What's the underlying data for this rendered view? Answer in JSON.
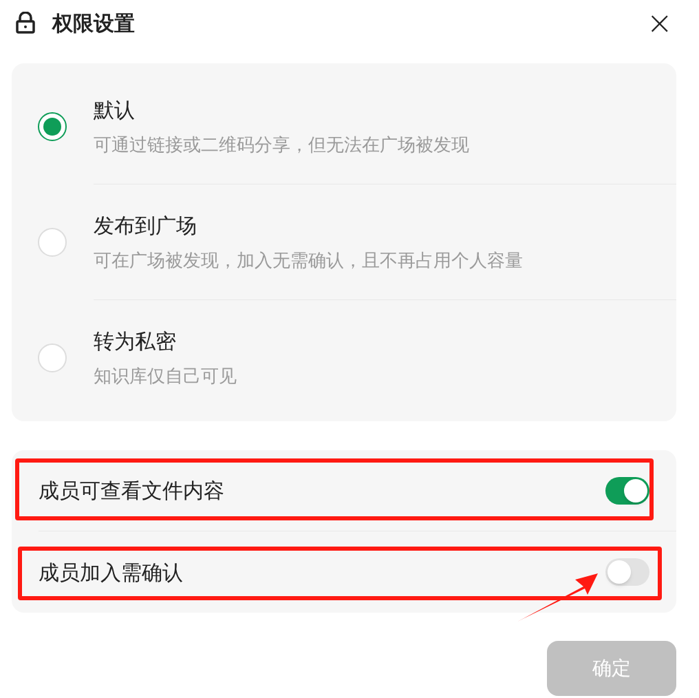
{
  "dialog": {
    "title": "权限设置",
    "close": "×"
  },
  "options": [
    {
      "label": "默认",
      "description": "可通过链接或二维码分享，但无法在广场被发现",
      "selected": true
    },
    {
      "label": "发布到广场",
      "description": "可在广场被发现，加入无需确认，且不再占用个人容量",
      "selected": false
    },
    {
      "label": "转为私密",
      "description": "知识库仅自己可见",
      "selected": false
    }
  ],
  "switches": [
    {
      "label": "成员可查看文件内容",
      "on": true,
      "highlighted": true
    },
    {
      "label": "成员加入需确认",
      "on": false,
      "highlighted": true,
      "pointed": true
    }
  ],
  "button": {
    "label": "确定",
    "disabled": true
  }
}
